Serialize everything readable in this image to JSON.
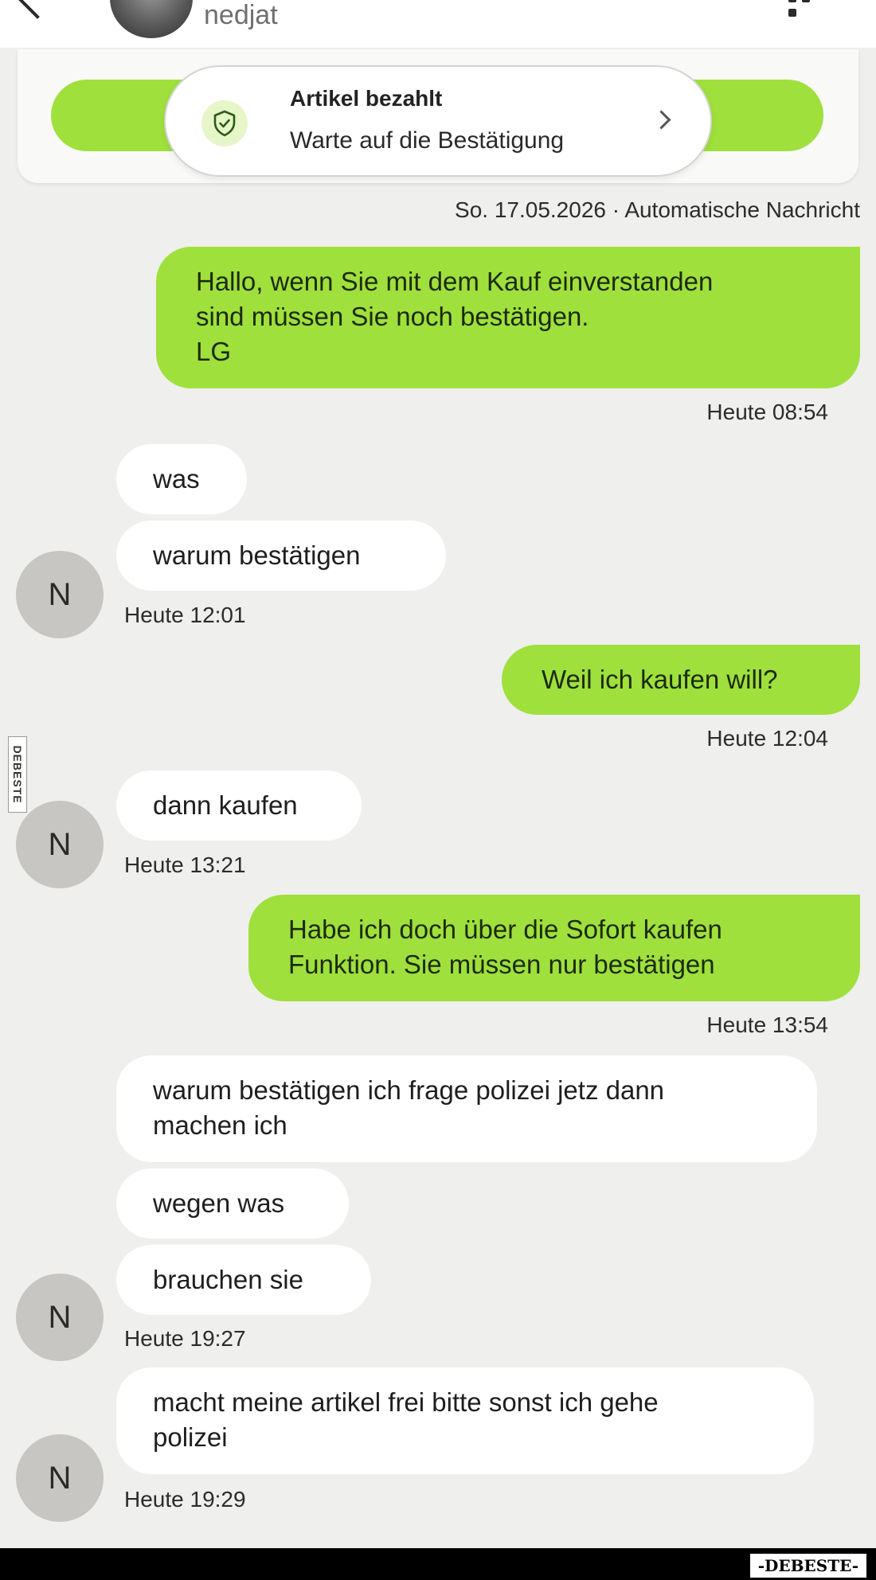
{
  "header": {
    "name": "nedjat"
  },
  "status": {
    "title": "Artikel bezahlt",
    "subtitle": "Warte auf die Bestätigung"
  },
  "auto_meta": "So. 17.05.2026 · Automatische Nachricht",
  "messages": [
    {
      "dir": "out",
      "lines": [
        "Hallo, wenn Sie mit dem Kauf einverstanden",
        "sind müssen Sie noch bestätigen.",
        "LG"
      ]
    },
    {
      "time": "Heute 08:54"
    },
    {
      "dir": "in",
      "lines": [
        "was"
      ]
    },
    {
      "dir": "in",
      "lines": [
        "warum bestätigen"
      ]
    },
    {
      "time": "Heute 12:01",
      "avatar": "N"
    },
    {
      "dir": "out",
      "lines": [
        "Weil ich kaufen will?"
      ]
    },
    {
      "time": "Heute 12:04"
    },
    {
      "dir": "in",
      "lines": [
        "dann kaufen"
      ]
    },
    {
      "time": "Heute 13:21",
      "avatar": "N"
    },
    {
      "dir": "out",
      "lines": [
        "Habe ich doch über die Sofort kaufen",
        "Funktion. Sie müssen nur bestätigen"
      ]
    },
    {
      "time": "Heute 13:54"
    },
    {
      "dir": "in",
      "lines": [
        "warum bestätigen ich frage polizei jetz dann",
        "machen ich"
      ]
    },
    {
      "dir": "in",
      "lines": [
        "wegen was"
      ]
    },
    {
      "dir": "in",
      "lines": [
        "brauchen sie"
      ]
    },
    {
      "time": "Heute 19:27",
      "avatar": "N"
    },
    {
      "dir": "in",
      "lines": [
        "macht meine artikel frei bitte sonst ich gehe",
        "polizei"
      ]
    },
    {
      "time": "Heute 19:29",
      "avatar": "N"
    }
  ],
  "watermark": {
    "side": "DEBESTE",
    "footer": "-DEBESTE-"
  },
  "colors": {
    "accent": "#9fe03d",
    "background": "#efefed",
    "bubble_in": "#ffffff"
  },
  "icons": [
    "back-arrow-icon",
    "menu-icon",
    "shield-check-icon",
    "chevron-right-icon"
  ]
}
